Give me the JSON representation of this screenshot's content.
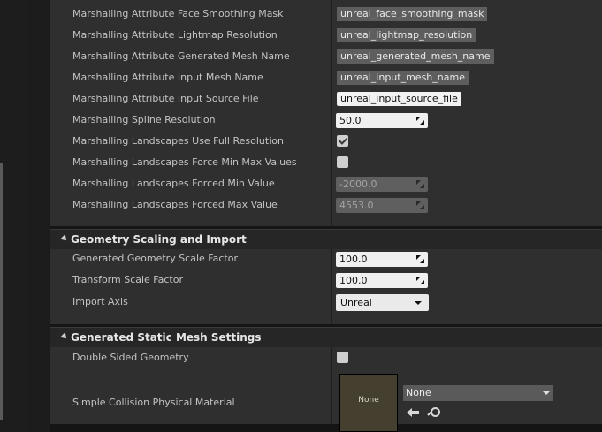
{
  "marshalling_rows": [
    {
      "label": "Marshalling Attribute Face Smoothing Mask",
      "value": "unreal_face_smoothing_mask"
    },
    {
      "label": "Marshalling Attribute Lightmap Resolution",
      "value": "unreal_lightmap_resolution"
    },
    {
      "label": "Marshalling Attribute Generated Mesh Name",
      "value": "unreal_generated_mesh_name"
    },
    {
      "label": "Marshalling Attribute Input Mesh Name",
      "value": "unreal_input_mesh_name"
    },
    {
      "label": "Marshalling Attribute Input Source File",
      "value": "unreal_input_source_file"
    },
    {
      "label": "Marshalling Spline Resolution",
      "value": "50.0"
    },
    {
      "label": "Marshalling Landscapes Use Full Resolution",
      "checked": true
    },
    {
      "label": "Marshalling Landscapes Force Min Max Values",
      "checked": false
    },
    {
      "label": "Marshalling Landscapes Forced Min Value",
      "value": "-2000.0"
    },
    {
      "label": "Marshalling Landscapes Forced Max Value",
      "value": "4553.0"
    }
  ],
  "geometry": {
    "title": "Geometry Scaling and Import",
    "rows": [
      {
        "label": "Generated Geometry Scale Factor",
        "value": "100.0"
      },
      {
        "label": "Transform Scale Factor",
        "value": "100.0"
      },
      {
        "label": "Import Axis",
        "value": "Unreal"
      }
    ]
  },
  "static_mesh": {
    "title": "Generated Static Mesh Settings",
    "rows": [
      {
        "label": "Double Sided Geometry",
        "checked": false
      },
      {
        "label": "Simple Collision Physical Material",
        "thumb_text": "None",
        "value": "None"
      }
    ]
  },
  "icons": {
    "collapse": "triangle-down-icon",
    "use_selected": "arrow-left-icon",
    "browse": "search-icon"
  },
  "colors": {
    "panel": "#2f2f2f",
    "header": "#262626",
    "field": "#f0f0f0",
    "disabled_field": "#5f5f5f"
  }
}
